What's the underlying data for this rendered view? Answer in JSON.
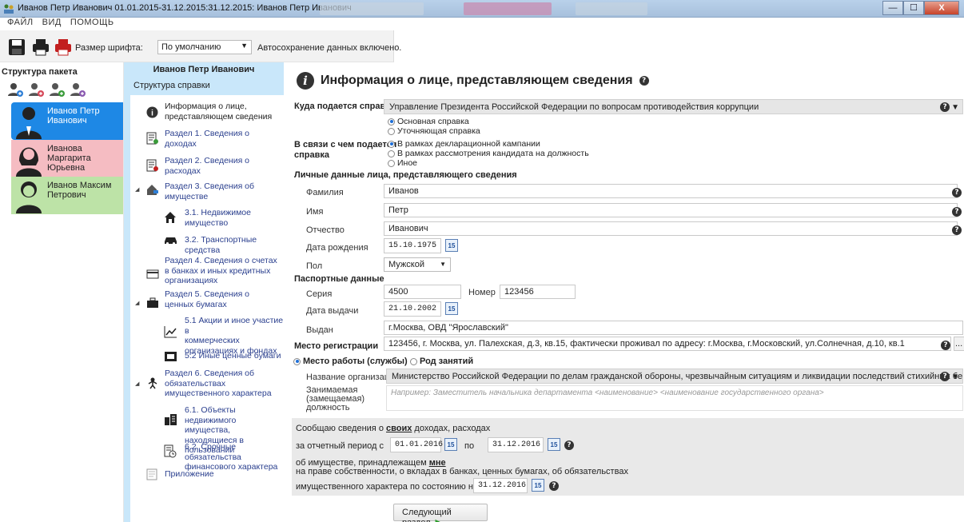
{
  "window": {
    "title": "Иванов Петр Иванович 01.01.2015-31.12.2015:31.12.2015: Иванов Петр Иванович",
    "min": "—",
    "max": "☐",
    "close": "X"
  },
  "menu": [
    "ФАЙЛ",
    "ВИД",
    "ПОМОЩЬ"
  ],
  "toolbar": {
    "font_size_label": "Размер шрифта:",
    "font_size_value": "По умолчанию",
    "autosave": "Автосохранение данных включено."
  },
  "package": {
    "title": "Структура пакета",
    "persons": [
      {
        "name_line1": "Иванов Петр",
        "name_line2": "Иванович",
        "name_line3": ""
      },
      {
        "name_line1": "Иванова",
        "name_line2": "Маргарита",
        "name_line3": "Юрьевна"
      },
      {
        "name_line1": "Иванов Максим",
        "name_line2": "Петрович",
        "name_line3": ""
      }
    ]
  },
  "structure": {
    "header": "Иванов Петр Иванович",
    "sub": "Структура справки",
    "items": [
      [
        "Информация о лице,",
        "представляющем сведения"
      ],
      [
        "Раздел 1. Сведения о",
        "доходах"
      ],
      [
        "Раздел 2. Сведения о",
        "расходах"
      ],
      [
        "Раздел 3. Сведения об",
        "имуществе"
      ],
      [
        "3.1. Недвижимое",
        "имущество"
      ],
      [
        "3.2. Транспортные средства"
      ],
      [
        "Раздел 4. Сведения о счетах",
        "в банках и иных кредитных",
        "организациях"
      ],
      [
        "Раздел 5. Сведения о",
        "ценных бумагах"
      ],
      [
        "5.1 Акции и иное участие в",
        "коммерческих",
        "организациях и фондах"
      ],
      [
        "5.2 Иные ценные бумаги"
      ],
      [
        "Раздел 6. Сведения об",
        "обязательствах",
        "имущественного характера"
      ],
      [
        "6.1. Объекты недвижимого",
        "имущества, находящиеся в",
        "пользовании"
      ],
      [
        "6.2. Срочные обязательства",
        "финансового характера"
      ],
      [
        "Приложение"
      ]
    ]
  },
  "form": {
    "title": "Информация о лице, представляющем сведения",
    "where_label": "Куда подается справка",
    "where_value": "Управление Президента Российской Федерации по вопросам противодействия коррупции",
    "type_options": [
      "Основная справка",
      "Уточняющая справка"
    ],
    "reason_label_1": "В связи с чем подается",
    "reason_label_2": "справка",
    "reason_options": [
      "В рамках декларационной кампании",
      "В рамках рассмотрения кандидата на должность",
      "Иное"
    ],
    "personal_header": "Личные данные лица, представляющего сведения",
    "surname_label": "Фамилия",
    "surname": "Иванов",
    "name_label": "Имя",
    "name": "Петр",
    "patronymic_label": "Отчество",
    "patronymic": "Иванович",
    "birth_label": "Дата рождения",
    "birth": "15.10.1975",
    "sex_label": "Пол",
    "sex": "Мужской",
    "passport_header": "Паспортные данные",
    "series_label": "Серия",
    "series": "4500",
    "number_label": "Номер",
    "number": "123456",
    "issue_date_label": "Дата выдачи",
    "issue_date": "21.10.2002",
    "issued_by_label": "Выдан",
    "issued_by": "г.Москва, ОВД \"Ярославский\"",
    "reg_label": "Место регистрации",
    "reg_value": "123456, г. Москва, ул. Палехская, д.3, кв.15, фактически проживал по адресу: г.Москва, г.Московский, ул.Солнечная, д.10, кв.1",
    "work_option": "Место работы (службы)",
    "occupation_option": "Род занятий",
    "org_label": "Название организации",
    "org_value": "Министерство Российской Федерации по делам гражданской обороны, чрезвычайным ситуациям и ликвидации последствий стихийных бедствий",
    "position_label_1": "Занимаемая",
    "position_label_2": "(замещаемая)",
    "position_label_3": "должность",
    "position_placeholder": "Например: Заместитель начальника департамента <наименование> <наименование государственного органа>",
    "report_line1_a": "Сообщаю сведения о ",
    "report_line1_b": "своих",
    "report_line1_c": " доходах, расходах",
    "period_from_label": "за отчетный период с",
    "period_from": "01.01.2016",
    "period_to_label": "по",
    "period_to": "31.12.2016",
    "report_line3_a": "об имуществе, принадлежащем ",
    "report_line3_b": "мне",
    "report_line4": "на праве собственности, о вкладах в банках, ценных бумагах, об обязательствах",
    "state_label": "имущественного характера по состоянию на",
    "state_date": "31.12.2016",
    "calendar_day": "15",
    "more_button": "...",
    "next_button": "Следующий раздел"
  },
  "colors": {
    "selected_person": "#1e88e5",
    "person2": "#f5bcc2",
    "person3": "#bde3a7",
    "structure_bg": "#c9e7fa"
  }
}
